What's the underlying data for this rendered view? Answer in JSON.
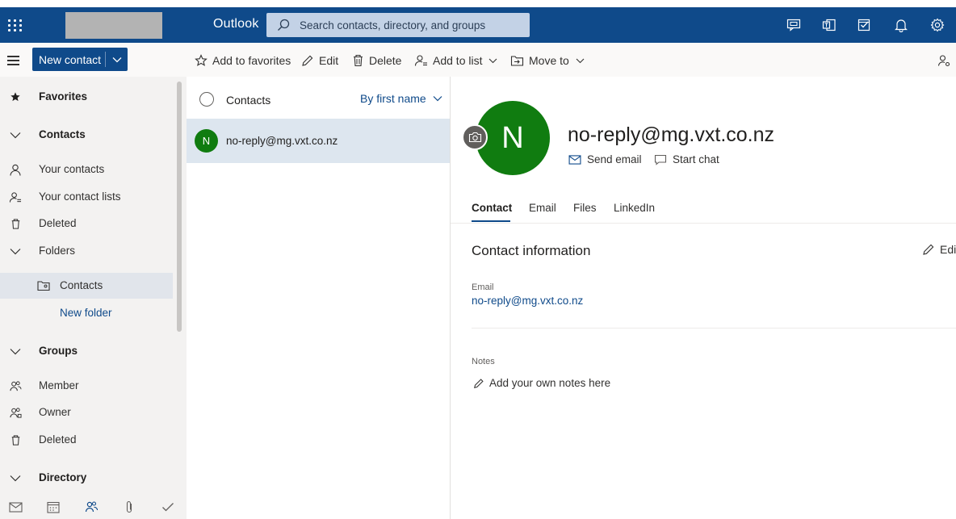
{
  "header": {
    "app_name": "Outlook",
    "search_placeholder": "Search contacts, directory, and groups",
    "icons": [
      "waffle-icon",
      "chat-icon",
      "teams-icon",
      "tasks-icon",
      "bell-icon",
      "gear-icon"
    ],
    "accent_color": "#0f4a8a"
  },
  "toolbar": {
    "new_contact_label": "New contact",
    "add_to_favorites": "Add to favorites",
    "edit": "Edit",
    "delete": "Delete",
    "add_to_list": "Add to list",
    "move_to": "Move to"
  },
  "sidebar": {
    "favorites": "Favorites",
    "contacts_header": "Contacts",
    "your_contacts": "Your contacts",
    "your_contact_lists": "Your contact lists",
    "deleted": "Deleted",
    "folders": "Folders",
    "folder_contacts": "Contacts",
    "new_folder": "New folder",
    "groups": "Groups",
    "member": "Member",
    "owner": "Owner",
    "groups_deleted": "Deleted",
    "directory": "Directory"
  },
  "list": {
    "title": "Contacts",
    "sort_label": "By first name",
    "items": [
      {
        "initial": "N",
        "name": "no-reply@mg.vxt.co.nz",
        "avatar_color": "#107c10"
      }
    ]
  },
  "detail": {
    "initial": "N",
    "name": "no-reply@mg.vxt.co.nz",
    "send_email": "Send email",
    "start_chat": "Start chat",
    "tabs": [
      "Contact",
      "Email",
      "Files",
      "LinkedIn"
    ],
    "section_title": "Contact information",
    "edit_label": "Edit",
    "email_label": "Email",
    "email_value": "no-reply@mg.vxt.co.nz",
    "notes_label": "Notes",
    "notes_placeholder": "Add your own notes here"
  }
}
